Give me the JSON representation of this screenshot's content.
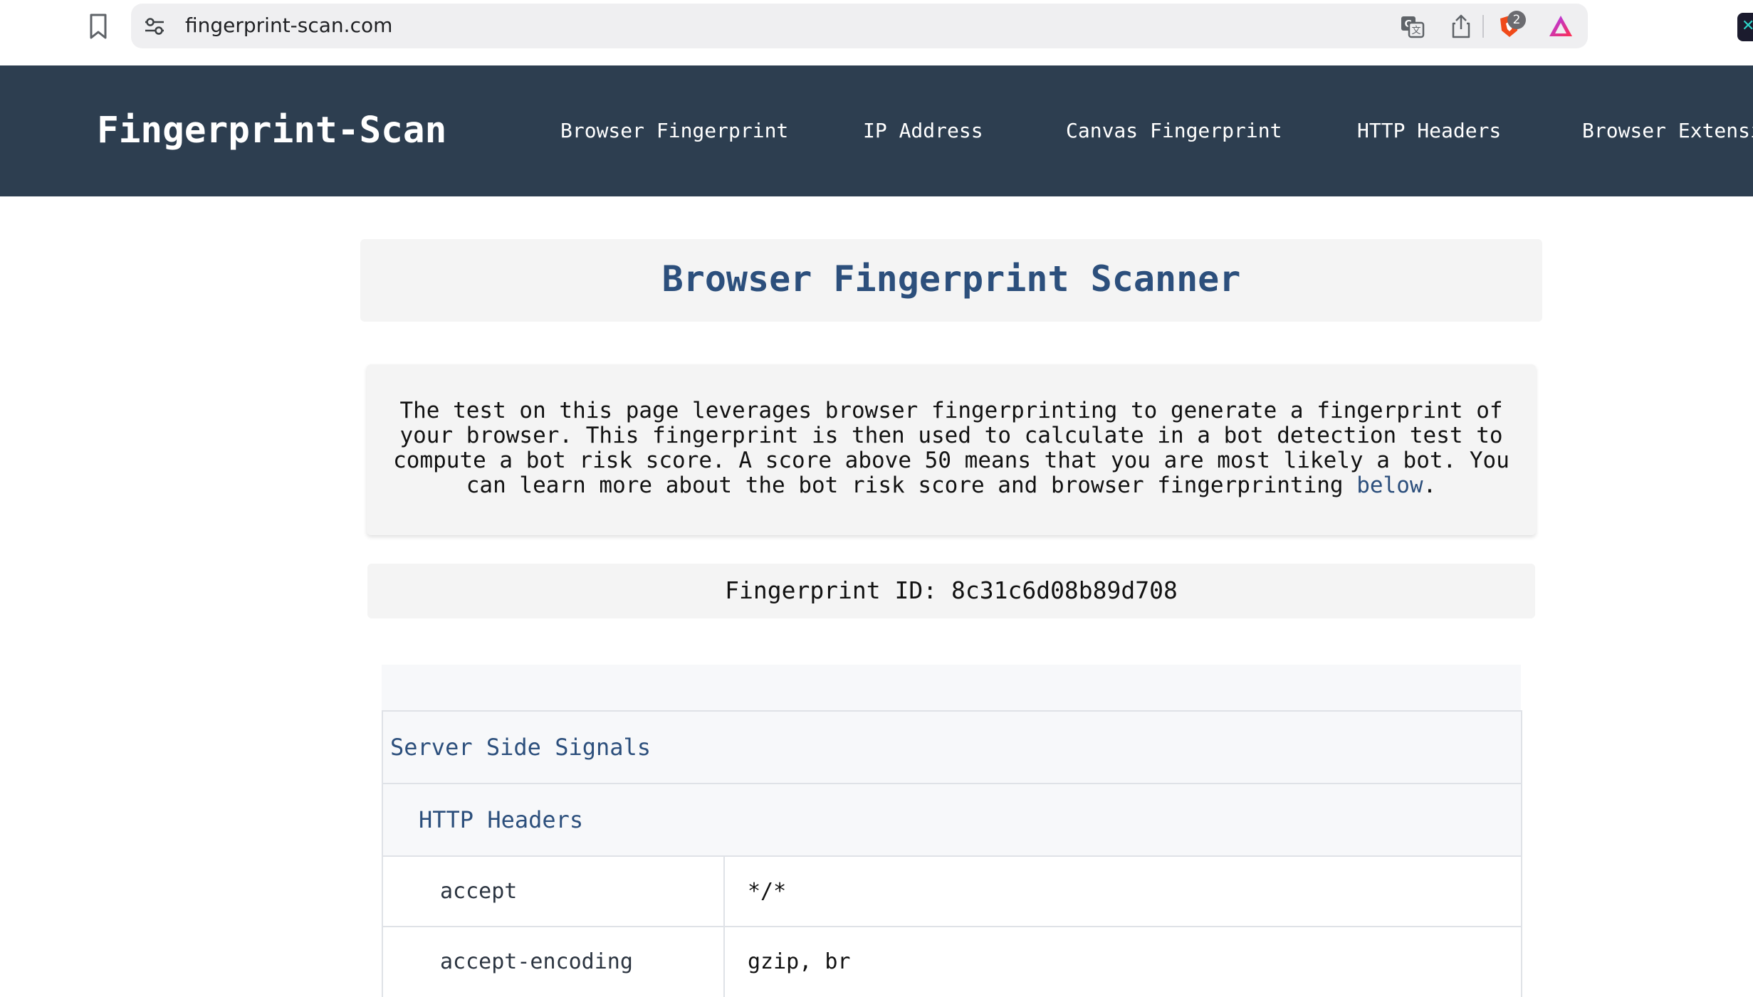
{
  "browser": {
    "url": "fingerprint-scan.com",
    "shields_count": "2",
    "icons": [
      "bookmark-icon",
      "site-settings-icon",
      "translate-icon",
      "share-icon",
      "brave-shields-icon",
      "brave-rewards-icon"
    ]
  },
  "nav": {
    "logo": "Fingerprint-Scan",
    "links": [
      "Browser Fingerprint",
      "IP Address",
      "Canvas Fingerprint",
      "HTTP Headers",
      "Browser Extensi"
    ]
  },
  "page": {
    "title": "Browser Fingerprint Scanner",
    "intro": "The test on this page leverages browser fingerprinting to generate a fingerprint of your browser. This fingerprint is then used to calculate in a bot detection test to compute a bot risk score. A score above 50 means that you are most likely a bot. You can learn more about the bot risk score and browser fingerprinting ",
    "intro_link": "below",
    "intro_end": ".",
    "fingerprint_id": "Fingerprint ID: 8c31c6d08b89d708"
  },
  "signals": {
    "section_title": "Server Side Signals",
    "subsection_title": "HTTP Headers",
    "rows": [
      {
        "key": "accept",
        "value": "*/*"
      },
      {
        "key": "accept-encoding",
        "value": "gzip, br"
      }
    ]
  },
  "colors": {
    "nav_bg": "#2d3e50",
    "heading": "#2c4f7c",
    "panel_bg": "#f4f4f4"
  }
}
